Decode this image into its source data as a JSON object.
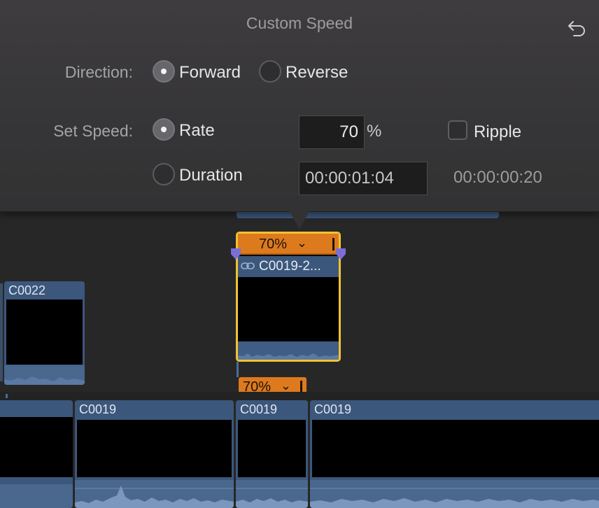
{
  "popover": {
    "title": "Custom Speed",
    "undo_icon": "undo-arrow-icon",
    "direction": {
      "label": "Direction:",
      "options": [
        {
          "label": "Forward",
          "selected": true
        },
        {
          "label": "Reverse",
          "selected": false
        }
      ]
    },
    "set_speed": {
      "label": "Set Speed:",
      "rate_label": "Rate",
      "rate_selected": true,
      "rate_value": "70",
      "rate_unit": "%",
      "duration_label": "Duration",
      "duration_selected": false,
      "duration_value": "00:00:01:04",
      "ripple_label": "Ripple",
      "ripple_checked": false,
      "duration_readout": "00:00:00:20"
    }
  },
  "timeline": {
    "selected_clip": {
      "speed_label": "70%",
      "title": "C0019-2..."
    },
    "speed_tag": "70%",
    "connected_clips": [
      {
        "title": "C0022"
      }
    ],
    "primary_clips": [
      {
        "title": ""
      },
      {
        "title": "C0019"
      },
      {
        "title": "C0019"
      },
      {
        "title": "C0019"
      }
    ]
  },
  "colors": {
    "clip_blue": "#3c577c",
    "speed_orange": "#dd7a1e",
    "selection_yellow": "#f1c232",
    "handle_purple": "#7a6fd8"
  }
}
